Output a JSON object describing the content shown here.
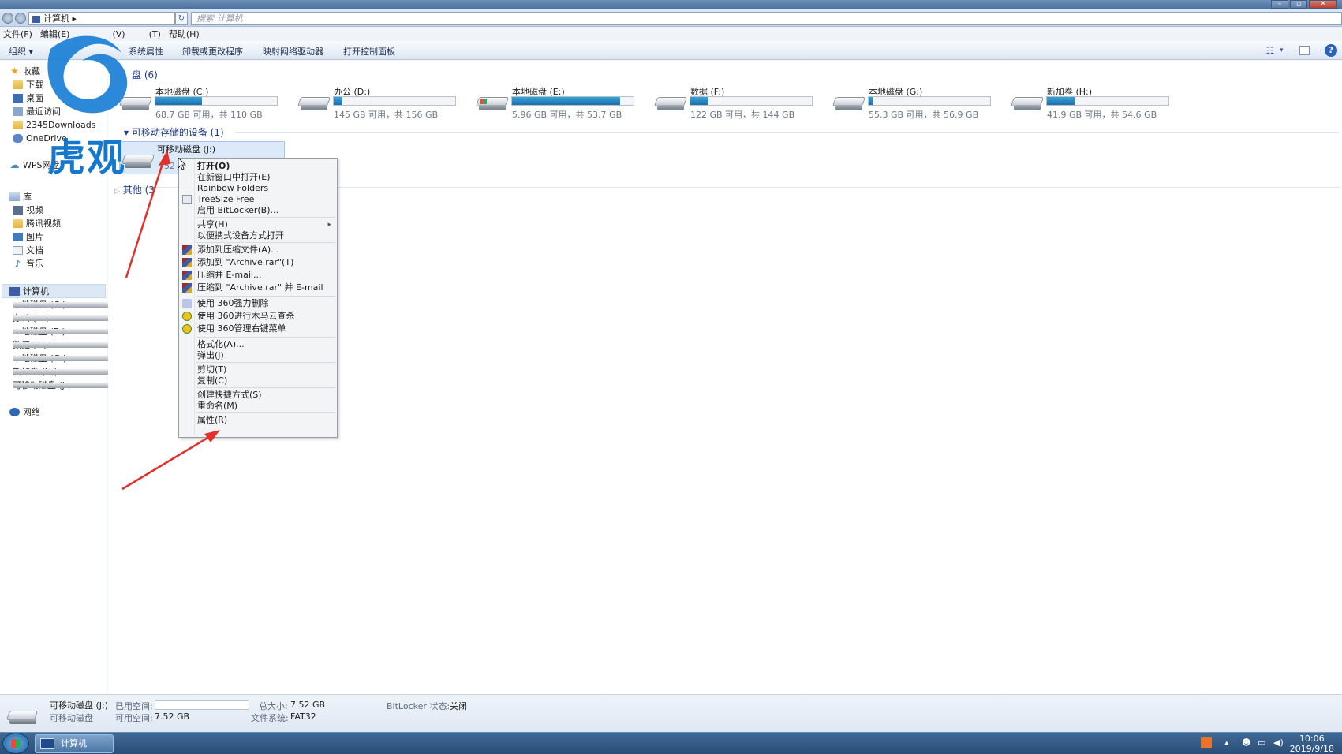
{
  "window": {
    "controls": [
      "minimize",
      "restore",
      "close"
    ]
  },
  "address": {
    "path": "计算机",
    "search_placeholder": "搜索 计算机"
  },
  "menu": [
    "文件(F)",
    "编辑(E)",
    "(V)",
    "(T)",
    "帮助(H)"
  ],
  "toolbar": {
    "organize": "组织",
    "items": [
      "系统属性",
      "卸载或更改程序",
      "映射网络驱动器",
      "打开控制面板"
    ]
  },
  "sidebar": {
    "favorites": [
      {
        "label": "收藏",
        "icon": "star-icon"
      },
      {
        "label": "下载",
        "icon": "folder-icon"
      },
      {
        "label": "桌面",
        "icon": "desktop-icon"
      },
      {
        "label": "最近访问",
        "icon": "recent-icon"
      },
      {
        "label": "2345Downloads",
        "icon": "folder-icon"
      },
      {
        "label": "OneDrive",
        "icon": "onedrive-icon"
      }
    ],
    "wps": "WPS网盘",
    "libraries": {
      "label": "库",
      "items": [
        "视频",
        "腾讯视频",
        "图片",
        "文档",
        "音乐"
      ]
    },
    "computer": {
      "label": "计算机",
      "items": [
        "本地磁盘 (C:)",
        "办公 (D:)",
        "本地磁盘 (E:)",
        "数据 (F:)",
        "本地磁盘 (G:)",
        "新加卷 (H:)",
        "可移动磁盘 (J:)"
      ]
    },
    "network": "网络"
  },
  "main": {
    "hard_disks_header": "盘 (6)",
    "drives": [
      {
        "name": "本地磁盘 (C:)",
        "info": "68.7 GB 可用，共 110 GB",
        "used_fraction": 0.38
      },
      {
        "name": "办公 (D:)",
        "info": "145 GB 可用，共 156 GB",
        "used_fraction": 0.07
      },
      {
        "name": "本地磁盘 (E:)",
        "info": "5.96 GB 可用，共 53.7 GB",
        "used_fraction": 0.89
      },
      {
        "name": "数据 (F:)",
        "info": "122 GB 可用，共 144 GB",
        "used_fraction": 0.15
      },
      {
        "name": "本地磁盘 (G:)",
        "info": "55.3 GB 可用，共 56.9 GB",
        "used_fraction": 0.03
      },
      {
        "name": "新加卷 (H:)",
        "info": "41.9 GB 可用，共 54.6 GB",
        "used_fraction": 0.23
      }
    ],
    "removable_header": "可移动存储的设备 (1)",
    "removable": {
      "name": "可移动磁盘 (J:)",
      "size": "52"
    },
    "other_header": "其他 (3"
  },
  "context_menu": {
    "groups": [
      [
        {
          "label": "打开(O)",
          "bold": true
        },
        {
          "label": "在新窗口中打开(E)"
        },
        {
          "label": "Rainbow Folders"
        },
        {
          "label": "TreeSize Free",
          "icon": "treesize-icon"
        },
        {
          "label": "启用 BitLocker(B)..."
        }
      ],
      [
        {
          "label": "共享(H)",
          "submenu": true
        },
        {
          "label": "以便携式设备方式打开"
        }
      ],
      [
        {
          "label": "添加到压缩文件(A)...",
          "icon": "winrar-icon"
        },
        {
          "label": "添加到 \"Archive.rar\"(T)",
          "icon": "winrar-icon"
        },
        {
          "label": "压缩并 E-mail...",
          "icon": "winrar-icon"
        },
        {
          "label": "压缩到 \"Archive.rar\" 并 E-mail",
          "icon": "winrar-icon"
        }
      ],
      [
        {
          "label": "使用 360强力删除",
          "icon": "purge-icon"
        },
        {
          "label": "使用 360进行木马云查杀",
          "icon": "360-icon"
        },
        {
          "label": "使用 360管理右键菜单",
          "icon": "360-icon"
        }
      ],
      [
        {
          "label": "格式化(A)..."
        },
        {
          "label": "弹出(J)"
        }
      ],
      [
        {
          "label": "剪切(T)"
        },
        {
          "label": "复制(C)"
        }
      ],
      [
        {
          "label": "创建快捷方式(S)"
        },
        {
          "label": "重命名(M)"
        }
      ],
      [
        {
          "label": "属性(R)"
        }
      ]
    ]
  },
  "details": {
    "name": "可移动磁盘 (J:)",
    "type": "可移动磁盘",
    "used_label": "已用空间:",
    "free_label": "可用空间:",
    "free_value": "7.52 GB",
    "total_label": "总大小:",
    "total_value": "7.52 GB",
    "fs_label": "文件系统:",
    "fs_value": "FAT32",
    "bitlocker_label": "BitLocker 状态:",
    "bitlocker_value": "关闭"
  },
  "taskbar": {
    "task_label": "计算机",
    "time": "10:06",
    "date": "2019/9/18"
  },
  "watermark": {
    "text": "虎观"
  },
  "colors": {
    "accent": "#1677cf",
    "drive_bar": "#1a6fae",
    "arrow": "#e0322a"
  }
}
